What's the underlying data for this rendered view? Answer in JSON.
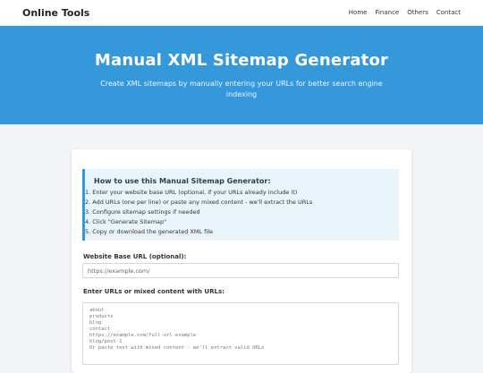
{
  "nav": {
    "brand": "Online Tools",
    "links": [
      "Home",
      "Finance",
      "Others",
      "Contact"
    ]
  },
  "hero": {
    "title": "Manual XML Sitemap Generator",
    "subtitle": "Create XML sitemaps by manually entering your URLs for better search engine indexing"
  },
  "instructions": {
    "heading": "How to use this Manual Sitemap Generator:",
    "steps": [
      "1. Enter your website base URL (optional, if your URLs already include it)",
      "2. Add URLs (one per line) or paste any mixed content - we'll extract the URLs",
      "3. Configure sitemap settings if needed",
      "4. Click \"Generate Sitemap\"",
      "5. Copy or download the generated XML file"
    ]
  },
  "form": {
    "base_url_label": "Website Base URL (optional):",
    "base_url_placeholder": "https://example.com/",
    "urls_label": "Enter URLs or mixed content with URLs:",
    "urls_placeholder": "about\nproducts\nblog\ncontact\nhttps://example.com/full-url-example\nblog/post-1\nOr paste text with mixed content - we'll extract valid URLs"
  },
  "colors": {
    "hero_bg": "#3498db",
    "accent": "#3498db"
  }
}
